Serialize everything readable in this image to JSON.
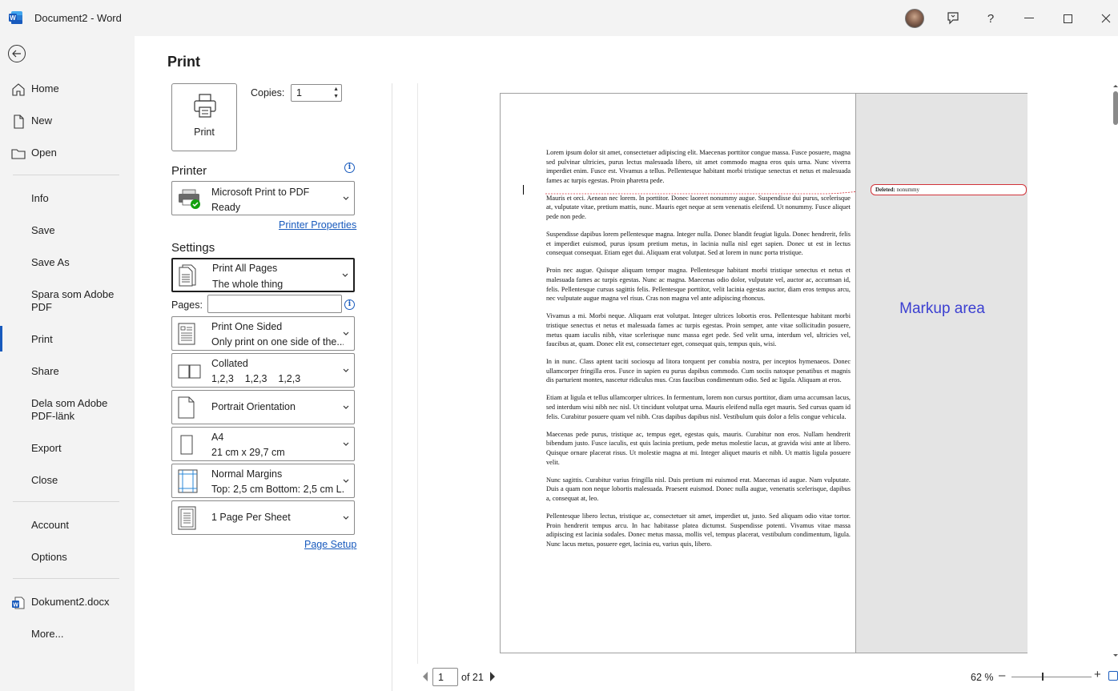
{
  "titlebar": {
    "title": "Document2  -  Word",
    "accent": "#185abd"
  },
  "nav": {
    "items": [
      {
        "label": "Home",
        "icon": "home-icon"
      },
      {
        "label": "New",
        "icon": "new-doc-icon"
      },
      {
        "label": "Open",
        "icon": "folder-icon"
      },
      {
        "label": "Info"
      },
      {
        "label": "Save"
      },
      {
        "label": "Save As"
      },
      {
        "label": "Spara som Adobe PDF"
      },
      {
        "label": "Print"
      },
      {
        "label": "Share"
      },
      {
        "label": "Dela som Adobe PDF-länk"
      },
      {
        "label": "Export"
      },
      {
        "label": "Close"
      },
      {
        "label": "Account"
      },
      {
        "label": "Options"
      },
      {
        "label": "Dokument2.docx",
        "icon": "word-file-icon"
      },
      {
        "label": "More..."
      }
    ],
    "active": "Print"
  },
  "print": {
    "title": "Print",
    "button_label": "Print",
    "copies_label": "Copies:",
    "copies_value": "1",
    "printer_heading": "Printer",
    "printer_name": "Microsoft Print to PDF",
    "printer_status": "Ready",
    "printer_properties": "Printer Properties",
    "settings_heading": "Settings",
    "pages_label": "Pages:",
    "pages_value": "",
    "page_setup": "Page Setup",
    "settings": [
      {
        "line1": "Print All Pages",
        "line2": "The whole thing"
      },
      {
        "line1": "Print One Sided",
        "line2": "Only print on one side of the..."
      },
      {
        "line1": "Collated",
        "line2": "1,2,3    1,2,3    1,2,3"
      },
      {
        "line1": "Portrait Orientation",
        "line2": ""
      },
      {
        "line1": "A4",
        "line2": "21 cm x 29,7 cm"
      },
      {
        "line1": "Normal Margins",
        "line2": "Top: 2,5 cm Bottom: 2,5 cm L..."
      },
      {
        "line1": "1 Page Per Sheet",
        "line2": ""
      }
    ]
  },
  "preview": {
    "markup_label": "Markup area",
    "balloon_prefix": "Deleted:",
    "balloon_text": "nonummy",
    "paragraphs": [
      "Lorem ipsum dolor sit amet, consectetuer adipiscing elit. Maecenas porttitor congue massa. Fusce posuere, magna sed pulvinar ultricies, purus lectus malesuada libero, sit amet commodo magna eros quis urna. Nunc viverra imperdiet enim. Fusce est. Vivamus a tellus. Pellentesque habitant morbi tristique senectus et netus et malesuada fames ac turpis egestas. Proin pharetra pede.",
      "Mauris et orci. Aenean nec lorem. In porttitor. Donec laoreet nonummy augue. Suspendisse dui purus, scelerisque at, vulputate vitae, pretium mattis, nunc. Mauris eget neque at sem venenatis eleifend. Ut nonummy. Fusce aliquet pede non pede.",
      "Suspendisse dapibus lorem pellentesque magna. Integer nulla. Donec blandit feugiat ligula. Donec hendrerit, felis et imperdiet euismod, purus ipsum pretium metus, in lacinia nulla nisl eget sapien. Donec ut est in lectus consequat consequat. Etiam eget dui. Aliquam erat volutpat. Sed at lorem in nunc porta tristique.",
      "Proin nec augue. Quisque aliquam tempor magna. Pellentesque habitant morbi tristique senectus et netus et malesuada fames ac turpis egestas. Nunc ac magna. Maecenas odio dolor, vulputate vel, auctor ac, accumsan id, felis. Pellentesque cursus sagittis felis. Pellentesque porttitor, velit lacinia egestas auctor, diam eros tempus arcu, nec vulputate augue magna vel risus. Cras non magna vel ante adipiscing rhoncus.",
      "Vivamus a mi. Morbi neque. Aliquam erat volutpat. Integer ultrices lobortis eros. Pellentesque habitant morbi tristique senectus et netus et malesuada fames ac turpis egestas. Proin semper, ante vitae sollicitudin posuere, metus quam iaculis nibh, vitae scelerisque nunc massa eget pede. Sed velit urna, interdum vel, ultricies vel, faucibus at, quam. Donec elit est, consectetuer eget, consequat quis, tempus quis, wisi.",
      "In in nunc. Class aptent taciti sociosqu ad litora torquent per conubia nostra, per inceptos hymenaeos. Donec ullamcorper fringilla eros. Fusce in sapien eu purus dapibus commodo. Cum sociis natoque penatibus et magnis dis parturient montes, nascetur ridiculus mus. Cras faucibus condimentum odio. Sed ac ligula. Aliquam at eros.",
      "Etiam at ligula et tellus ullamcorper ultrices. In fermentum, lorem non cursus porttitor, diam urna accumsan lacus, sed interdum wisi nibh nec nisl. Ut tincidunt volutpat urna. Mauris eleifend nulla eget mauris. Sed cursus quam id felis. Curabitur posuere quam vel nibh. Cras dapibus dapibus nisl. Vestibulum quis dolor a felis congue vehicula.",
      "Maecenas pede purus, tristique ac, tempus eget, egestas quis, mauris. Curabitur non eros. Nullam hendrerit bibendum justo. Fusce iaculis, est quis lacinia pretium, pede metus molestie lacus, at gravida wisi ante at libero. Quisque ornare placerat risus. Ut molestie magna at mi. Integer aliquet mauris et nibh. Ut mattis ligula posuere velit.",
      "Nunc sagittis. Curabitur varius fringilla nisl. Duis pretium mi euismod erat. Maecenas id augue. Nam vulputate. Duis a quam non neque lobortis malesuada. Praesent euismod. Donec nulla augue, venenatis scelerisque, dapibus a, consequat at, leo.",
      "Pellentesque libero lectus, tristique ac, consectetuer sit amet, imperdiet ut, justo. Sed aliquam odio vitae tortor. Proin hendrerit tempus arcu. In hac habitasse platea dictumst. Suspendisse potenti. Vivamus vitae massa adipiscing est lacinia sodales. Donec metus massa, mollis vel, tempus placerat, vestibulum condimentum, ligula. Nunc lacus metus, posuere eget, lacinia eu, varius quis, libero."
    ]
  },
  "pager": {
    "current": "1",
    "of_label": "of 21"
  },
  "zoom": {
    "percent_label": "62 %",
    "level": 62
  }
}
